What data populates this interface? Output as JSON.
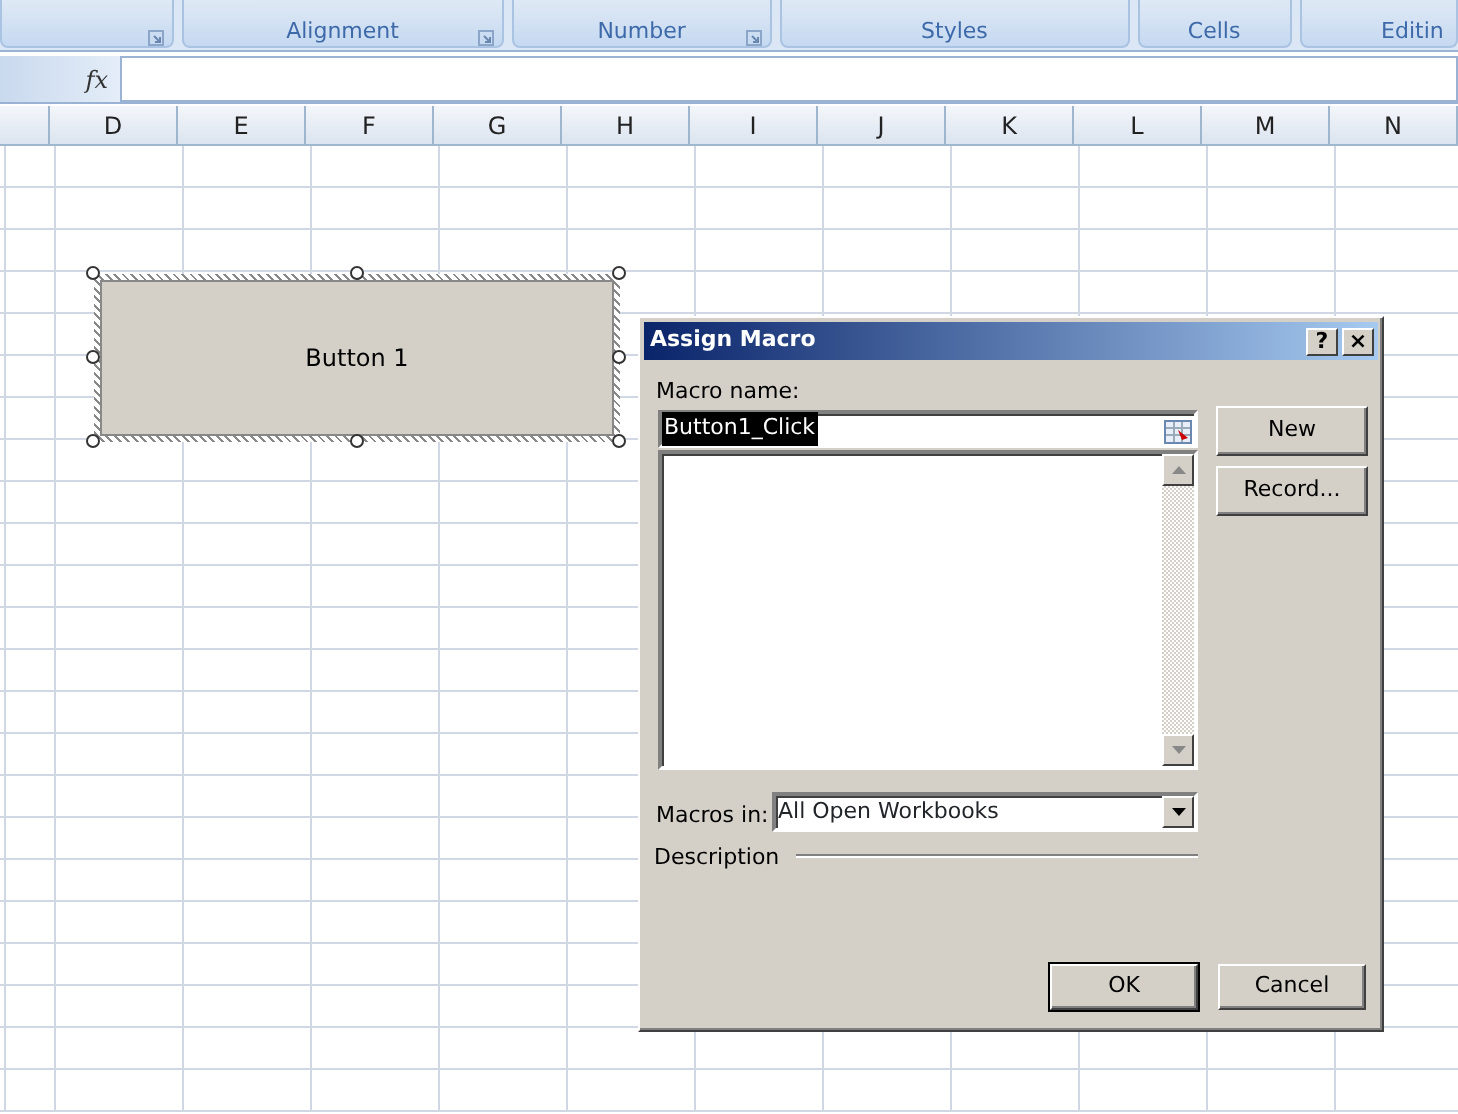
{
  "ribbon": {
    "groups": [
      {
        "launcher": true
      },
      {
        "label": "Alignment",
        "launcher": true
      },
      {
        "label": "Number",
        "launcher": true
      },
      {
        "label": "Styles",
        "launcher": false
      },
      {
        "label": "Cells",
        "launcher": false
      },
      {
        "label": "Editin",
        "launcher": false
      }
    ]
  },
  "formula_bar": {
    "fx": "fx"
  },
  "columns": [
    "D",
    "E",
    "F",
    "G",
    "H",
    "I",
    "J",
    "K",
    "L",
    "M",
    "N"
  ],
  "sheet_button": {
    "label": "Button 1",
    "selected": true
  },
  "dialog": {
    "title": "Assign Macro",
    "help": "?",
    "close": "×",
    "macro_name_label": "Macro name:",
    "macro_name_value": "Button1_Click",
    "buttons_side": [
      "New",
      "Record..."
    ],
    "macros_in_label": "Macros in:",
    "macros_in_value": "All Open Workbooks",
    "description_label": "Description",
    "buttons_bottom": [
      {
        "label": "OK",
        "default": true
      },
      {
        "label": "Cancel",
        "default": false
      }
    ]
  }
}
